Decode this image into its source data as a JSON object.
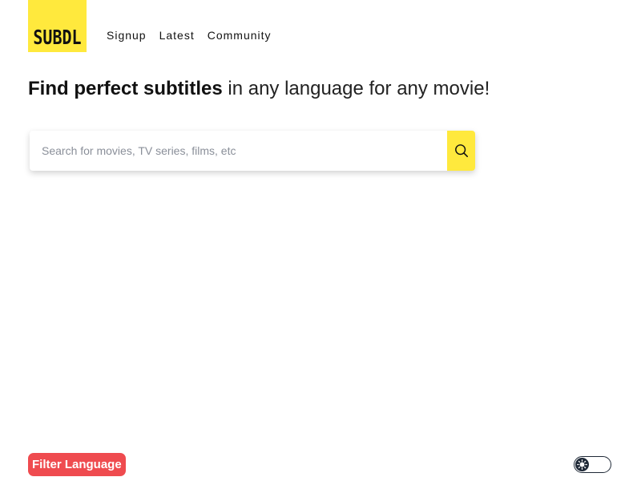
{
  "header": {
    "logo_text": "SUBDL",
    "nav": [
      {
        "label": "Signup"
      },
      {
        "label": "Latest"
      },
      {
        "label": "Community"
      }
    ]
  },
  "hero": {
    "title_bold": "Find perfect subtitles",
    "title_rest": " in any language for any movie!"
  },
  "search": {
    "placeholder": "Search for movies, TV series, films, etc",
    "value": "",
    "button_icon": "search-icon"
  },
  "footer": {
    "filter_label": "Filter Language",
    "theme_toggle_icon": "theme-toggle-icon",
    "theme_toggle_state": "off"
  },
  "colors": {
    "brand_yellow": "#ffe93d",
    "filter_red": "#ef4b4f",
    "toggle_dark": "#1f2937"
  }
}
